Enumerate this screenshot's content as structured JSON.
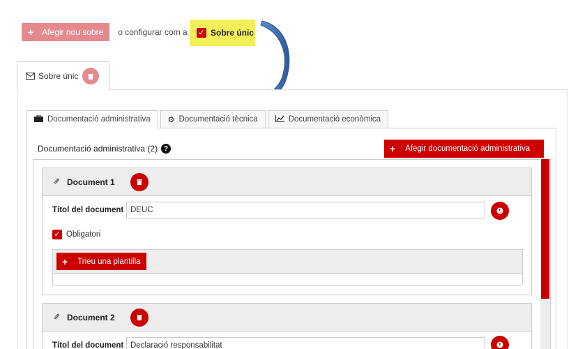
{
  "toolbar": {
    "add_sobre_label": "Afegir nou sobre",
    "or_text": "o configurar com a",
    "sobre_unic_label": "Sobre únic"
  },
  "outer_tab": {
    "label": "Sobre únic"
  },
  "inner_tabs": [
    {
      "label": "Documentació administrativa",
      "icon": "briefcase-icon"
    },
    {
      "label": "Documentació tècnica",
      "icon": "gears-icon"
    },
    {
      "label": "Documentació econòmica",
      "icon": "line-chart-icon"
    }
  ],
  "section": {
    "title": "Documentació administrativa (2)",
    "add_button": "Afegir documentació administrativa"
  },
  "documents": [
    {
      "title": "Document 1",
      "field_label": "Títol del document",
      "field_value": "DEUC",
      "required_label": "Obligatori",
      "template_button": "Trieu una plantilla"
    },
    {
      "title": "Document 2",
      "field_label": "Títol del document",
      "field_value": "Declaració responsabilitat"
    }
  ],
  "colors": {
    "accent": "#cc0000",
    "accent_light": "#e48a8f",
    "highlight": "#f3ef5b",
    "arrow": "#3a6fb0"
  }
}
